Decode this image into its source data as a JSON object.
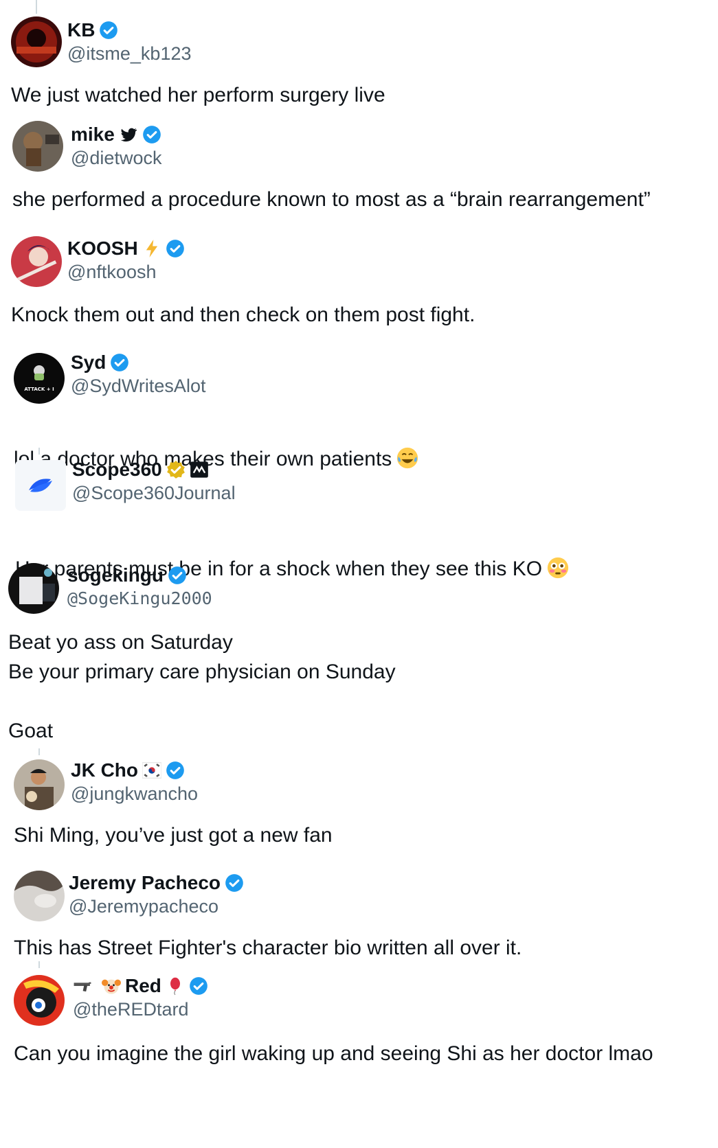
{
  "colors": {
    "verified": "#1d9bf0",
    "gold": "#e2b719",
    "handle": "#536471",
    "text": "#0f1419"
  },
  "tweets": [
    {
      "name": "KB",
      "handle": "@itsme_kb123",
      "body": "We just watched her perform surgery live",
      "badge": "verified-blue-icon"
    },
    {
      "name": "mike",
      "name_icon": "bird-icon",
      "handle": "@dietwock",
      "body": "she performed a procedure known to most as a “brain rearrangement”",
      "badge": "verified-blue-icon"
    },
    {
      "name": "KOOSH",
      "name_icon": "lightning-icon",
      "handle": "@nftkoosh",
      "body": "Knock them out and then check on them post fight.",
      "badge": "verified-blue-icon"
    },
    {
      "name": "Syd",
      "handle": "@SydWritesAlot",
      "body": "lol a doctor who makes their own patients",
      "body_emoji": "laughing-crying-emoji",
      "badge": "verified-blue-icon",
      "avatar_text": "ATTACK + I"
    },
    {
      "name": "Scope360",
      "handle": "@Scope360Journal",
      "body": "Her parents must be in for a shock when they see this KO",
      "body_emoji": "flushed-emoji",
      "badge": "verified-gold-icon",
      "affiliate": "affiliate-logo-icon"
    },
    {
      "name": "sogekingu",
      "handle": "@SogeKingu2000",
      "body": "Beat yo ass on Saturday\nBe your primary care physician on Sunday\n\nGoat",
      "badge": "verified-blue-icon"
    },
    {
      "name": "JK Cho",
      "name_icon": "korea-flag-icon",
      "handle": "@jungkwancho",
      "body": "Shi Ming, you’ve just got a new fan",
      "badge": "verified-blue-icon"
    },
    {
      "name": "Jeremy Pacheco",
      "handle": "@Jeremypacheco",
      "body": "This has Street Fighter's character bio written all over it.",
      "badge": "verified-blue-icon"
    },
    {
      "name": "Red",
      "name_prefix_icons": [
        "gun-icon",
        "clown-icon"
      ],
      "name_icon": "balloon-icon",
      "handle": "@theREDtard",
      "body": "Can you imagine the girl waking up and seeing Shi as her doctor lmao",
      "badge": "verified-blue-icon"
    }
  ]
}
